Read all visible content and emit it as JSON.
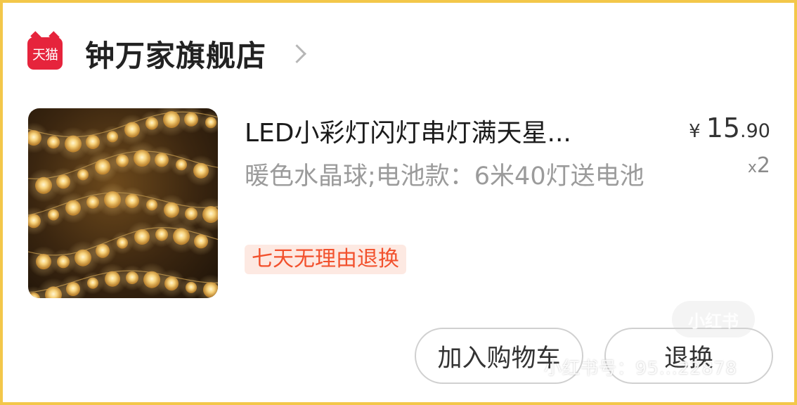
{
  "shop": {
    "logo_text": "天猫",
    "name": "钟万家旗舰店"
  },
  "product": {
    "image_icon": "led-string-lights-image",
    "title": "LED小彩灯闪灯串灯满天星...",
    "spec": "暖色水晶球;电池款：6米40灯送电池",
    "tag": "七天无理由退换",
    "price_currency": "¥",
    "price_integer": "15",
    "price_decimal": ".90",
    "qty_prefix": "x",
    "qty_value": "2"
  },
  "actions": {
    "add_to_cart": "加入购物车",
    "return_exchange": "退换"
  },
  "watermark": {
    "logo": "小红书",
    "id_text": "小红书号：95...22878"
  },
  "colors": {
    "frame": "#f3c74a",
    "tmall_red": "#e6243c",
    "tag_text": "#f2512d",
    "tag_bg": "#fde9e2"
  }
}
